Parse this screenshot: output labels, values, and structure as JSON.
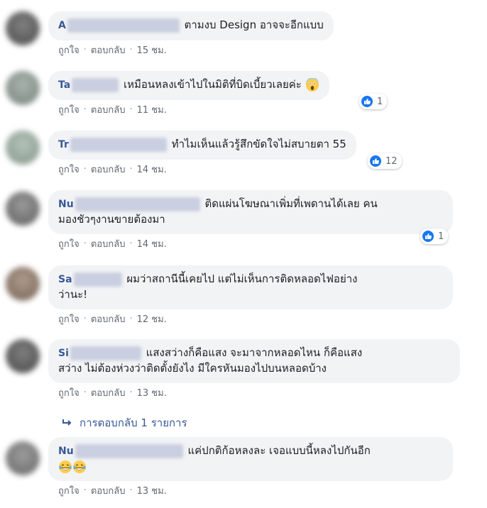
{
  "comments": [
    {
      "author": "A",
      "text_after": "ตามงบ Design อาจจะอีกแบบ",
      "actions": {
        "like": "ถูกใจ",
        "reply": "ตอบกลับ",
        "time": "15 ชม."
      }
    },
    {
      "author": "Ta",
      "text_after": "เหมือนหลงเข้าไปในมิติที่บิดเบี้ยวเลยค่ะ",
      "reaction_count": "1",
      "actions": {
        "like": "ถูกใจ",
        "reply": "ตอบกลับ",
        "time": "11 ชม."
      }
    },
    {
      "author": "Tr",
      "text_after": "ทำไมเห็นแล้วรู้สึกขัดใจไม่สบายตา 55",
      "reaction_count": "12",
      "actions": {
        "like": "ถูกใจ",
        "reply": "ตอบกลับ",
        "time": "14 ชม."
      }
    },
    {
      "author": "Nu",
      "line1": "ติดแผ่นโฆษณาเพิ่มที่เพดานได้เลย คน",
      "line2": "มองชัวๆงานขายต้องมา",
      "reaction_count": "1",
      "actions": {
        "like": "ถูกใจ",
        "reply": "ตอบกลับ",
        "time": "14 ชม."
      }
    },
    {
      "author": "Sa",
      "line1": "ผมว่าสถานีนี้เคยไป แต่ไม่เห็นการติดหลอดไฟอย่าง",
      "line2": "ว่านะ!",
      "actions": {
        "like": "ถูกใจ",
        "reply": "ตอบกลับ",
        "time": "12 ชม."
      }
    },
    {
      "author": "Si",
      "line1": "แสงสว่างก็คือแสง จะมาจากหลอดไหน ก็คือแสง",
      "line2": "สว่าง ไม่ต้องห่วงว่าติดตั้งยังไง มีใครหันมองไปบนหลอดบ้าง",
      "actions": {
        "like": "ถูกใจ",
        "reply": "ตอบกลับ",
        "time": "13 ชม."
      }
    },
    {
      "author": "Nu",
      "line1": "แค่ปกติก้อหลงละ เจอแบบนี้หลงไปกันอีก",
      "actions": {
        "like": "ถูกใจ",
        "reply": "ตอบกลับ",
        "time": "13 ชม."
      }
    }
  ],
  "replies_link": "การตอบกลับ 1 รายการ",
  "separator": "·",
  "colors": {
    "author": "#385898",
    "bubble": "#f2f3f5",
    "like_blue": "#1877f2",
    "meta": "#606770"
  },
  "icons": [
    "like-icon",
    "scream-emoji-icon",
    "laughing-tears-emoji-icon",
    "reply-arrow-icon"
  ]
}
